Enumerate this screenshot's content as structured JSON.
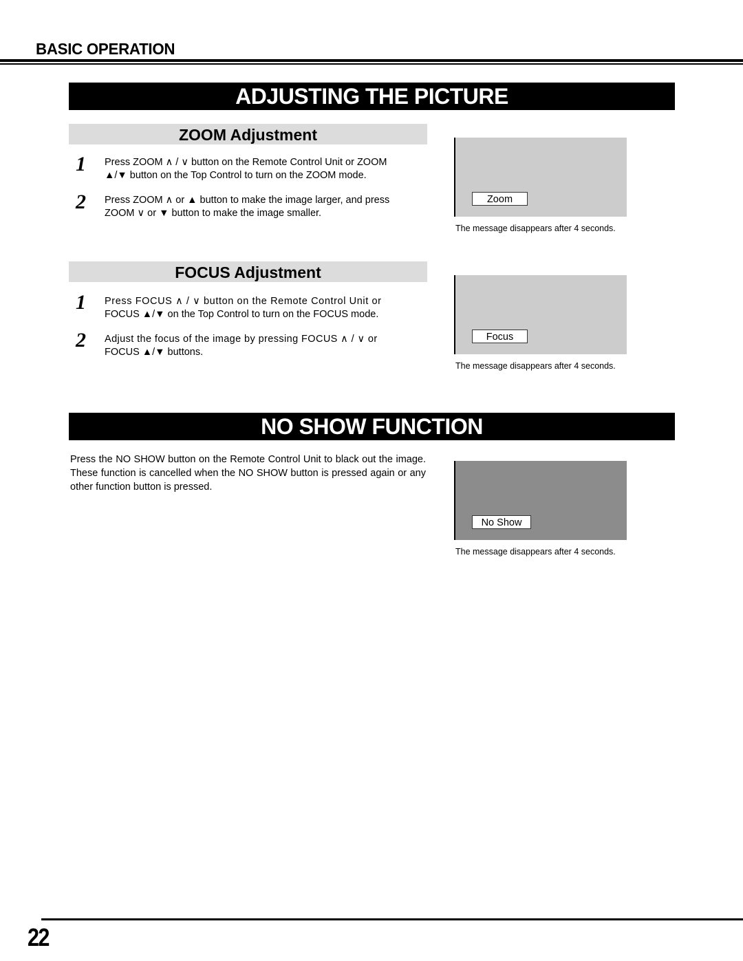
{
  "header": {
    "section_label": "BASIC OPERATION"
  },
  "adjusting": {
    "title": "ADJUSTING THE PICTURE",
    "zoom": {
      "heading": "ZOOM Adjustment",
      "steps": [
        {
          "number": "1",
          "lines": [
            "Press ZOOM ∧ / ∨  button on the Remote Control Unit or ZOOM",
            "▲/▼ button on the Top Control to turn on the ZOOM mode."
          ]
        },
        {
          "number": "2",
          "lines": [
            "Press ZOOM ∧  or ▲ button to make the image larger, and press",
            "ZOOM ∨  or ▼ button to make the image smaller."
          ]
        }
      ],
      "screen_message": "Zoom",
      "caption": "The message disappears after 4 seconds."
    },
    "focus": {
      "heading": "FOCUS Adjustment",
      "steps": [
        {
          "number": "1",
          "lines": [
            "Press FOCUS ∧ / ∨  button on the Remote Control Unit or",
            "FOCUS ▲/▼  on the Top Control to turn on the FOCUS mode."
          ]
        },
        {
          "number": "2",
          "lines": [
            "Adjust the focus of the image by pressing FOCUS ∧ / ∨  or",
            "FOCUS ▲/▼  buttons."
          ]
        }
      ],
      "screen_message": "Focus",
      "caption": "The message disappears after 4 seconds."
    }
  },
  "no_show": {
    "title": "NO SHOW FUNCTION",
    "description": "Press the NO SHOW button on the Remote Control Unit to black out the image.  These function is cancelled when the NO SHOW button is pressed again or any other function button is pressed.",
    "screen_message": "No Show",
    "caption": "The message disappears after 4 seconds."
  },
  "footer": {
    "page_number": "22"
  },
  "colors": {
    "banner_bg": "#000000",
    "subhead_bg": "#dcdcdc",
    "screen_light": "#cccccc",
    "screen_dark": "#8c8c8c"
  }
}
